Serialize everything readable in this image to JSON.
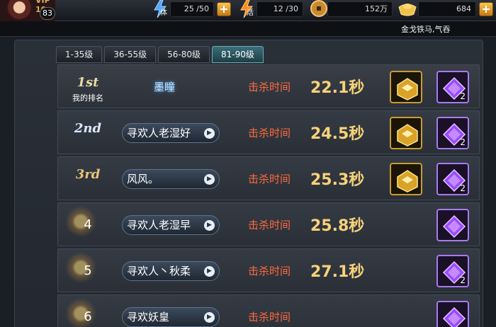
{
  "header": {
    "vip": "VIP 10",
    "level": "83",
    "stamina": {
      "label": "体",
      "value": "25 /50"
    },
    "activity": {
      "label": "活",
      "value": "12 /30"
    },
    "coins": "152万",
    "gold": "684",
    "ticker": "金戈铁马,气吞"
  },
  "tabs": [
    {
      "label": "1-35级",
      "active": false
    },
    {
      "label": "36-55级",
      "active": false
    },
    {
      "label": "56-80级",
      "active": false
    },
    {
      "label": "81-90级",
      "active": true
    }
  ],
  "kill_label": "击杀时间",
  "my_rank_label": "我的排名",
  "rows": [
    {
      "rank": "1st",
      "player": "墨瞳",
      "time": "22.1秒",
      "has_gold": true,
      "gem_count": "2"
    },
    {
      "rank": "2nd",
      "player": "寻欢人老湿好",
      "time": "24.5秒",
      "has_gold": true,
      "gem_count": "2"
    },
    {
      "rank": "3rd",
      "player": "风风。",
      "time": "25.3秒",
      "has_gold": true,
      "gem_count": "2"
    },
    {
      "rank": "4",
      "player": "寻欢人老湿早",
      "time": "25.8秒",
      "has_gold": false,
      "gem_count": ""
    },
    {
      "rank": "5",
      "player": "寻欢人丶秋柔",
      "time": "27.1秒",
      "has_gold": false,
      "gem_count": "2"
    },
    {
      "rank": "6",
      "player": "寻欢妖皇",
      "time": "",
      "has_gold": false,
      "gem_count": ""
    }
  ]
}
